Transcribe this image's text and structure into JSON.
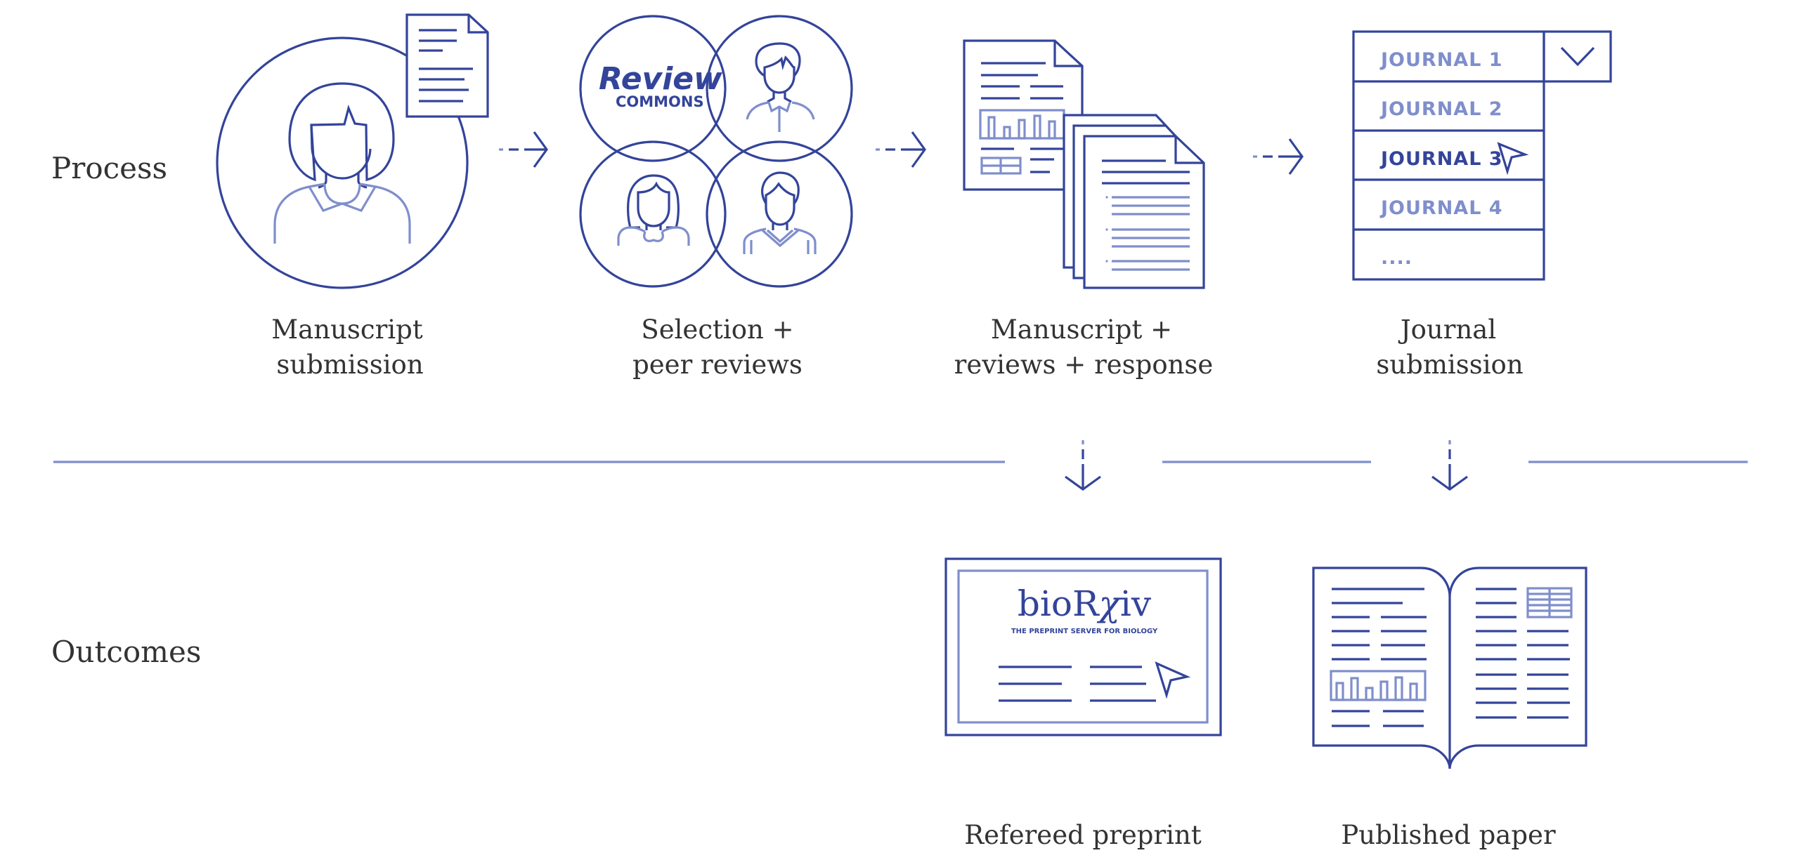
{
  "sections": {
    "process": "Process",
    "outcomes": "Outcomes"
  },
  "process_steps": [
    {
      "id": "manuscript-submission",
      "line1": "Manuscript",
      "line2": "submission",
      "icon": "author-with-document-icon"
    },
    {
      "id": "selection-peer-reviews",
      "line1": "Selection +",
      "line2": "peer reviews",
      "icon": "review-commons-reviewers-icon"
    },
    {
      "id": "manuscript-reviews-response",
      "line1": "Manuscript +",
      "line2": "reviews + response",
      "icon": "stacked-documents-icon"
    },
    {
      "id": "journal-submission",
      "line1": "Journal",
      "line2": "submission",
      "icon": "journal-dropdown-icon"
    }
  ],
  "review_commons_logo": {
    "word1": "Review",
    "word2": "COMMONS"
  },
  "journal_dropdown": {
    "options": [
      "JOURNAL 1",
      "JOURNAL 2",
      "JOURNAL 3",
      "JOURNAL 4",
      "...."
    ],
    "selected_index": 2
  },
  "outcomes": [
    {
      "id": "refereed-preprint",
      "label": "Refereed preprint",
      "icon": "biorxiv-screen-icon"
    },
    {
      "id": "published-paper",
      "label": "Published paper",
      "icon": "open-book-icon"
    }
  ],
  "biorxiv_logo": {
    "name_prefix": "bioR",
    "name_chi": "χ",
    "name_suffix": "iv",
    "tagline": "THE PREPRINT SERVER FOR BIOLOGY"
  },
  "colors": {
    "primary": "#33449a",
    "secondary": "#7f8ecc",
    "text": "#333333",
    "background": "#ffffff"
  }
}
